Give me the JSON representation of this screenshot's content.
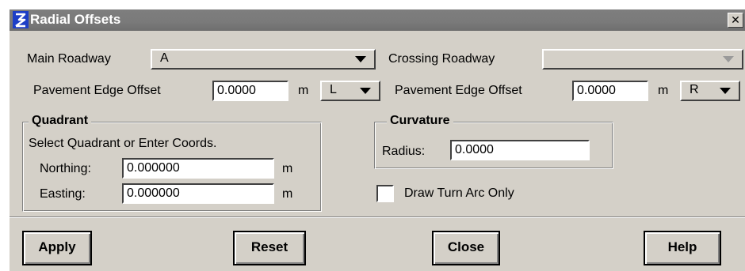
{
  "window": {
    "title": "Radial Offsets",
    "close_glyph": "✕"
  },
  "main_roadway": {
    "label": "Main Roadway",
    "value": "A"
  },
  "crossing_roadway": {
    "label": "Crossing Roadway",
    "value": ""
  },
  "left_offset": {
    "label": "Pavement Edge Offset",
    "value": "0.0000",
    "unit": "m",
    "side": "L"
  },
  "right_offset": {
    "label": "Pavement Edge Offset",
    "value": "0.0000",
    "unit": "m",
    "side": "R"
  },
  "quadrant": {
    "title": "Quadrant",
    "instruction": "Select Quadrant or Enter Coords.",
    "northing_label": "Northing:",
    "northing_value": "0.000000",
    "northing_unit": "m",
    "easting_label": "Easting:",
    "easting_value": "0.000000",
    "easting_unit": "m"
  },
  "curvature": {
    "title": "Curvature",
    "radius_label": "Radius:",
    "radius_value": "0.0000"
  },
  "draw_turn_arc": {
    "label": "Draw Turn Arc Only",
    "checked": false
  },
  "buttons": {
    "apply": "Apply",
    "reset": "Reset",
    "close": "Close",
    "help": "Help"
  },
  "icons": {
    "app_logo": "app-logo-icon",
    "close": "close-icon",
    "dropdown": "dropdown-arrow-icon"
  },
  "colors": {
    "title_bar": "#7a7a7a",
    "dialog_bg": "#d4d0c8",
    "logo_blue": "#1d3fc7"
  }
}
